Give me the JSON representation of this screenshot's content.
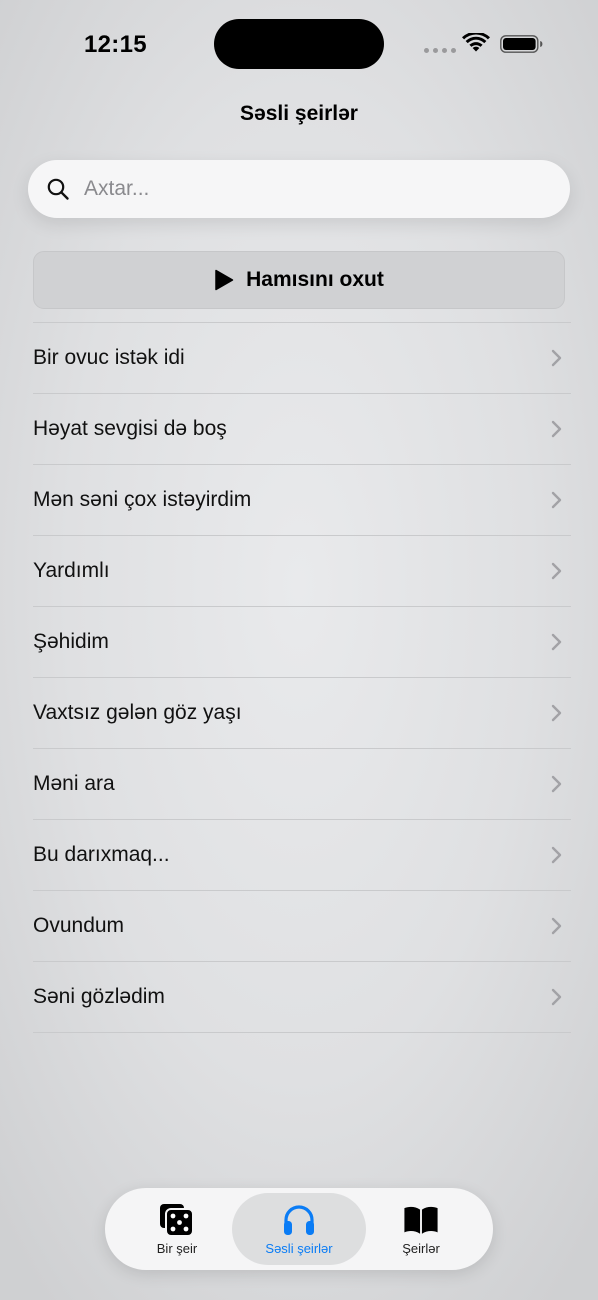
{
  "status_bar": {
    "time": "12:15"
  },
  "header": {
    "title": "Səsli şeirlər"
  },
  "search": {
    "placeholder": "Axtar...",
    "value": ""
  },
  "play_all": {
    "label": "Hamısını oxut"
  },
  "poems": [
    {
      "title": "Bir ovuc istək idi"
    },
    {
      "title": "Həyat sevgisi də boş"
    },
    {
      "title": "Mən səni çox istəyirdim"
    },
    {
      "title": "Yardımlı"
    },
    {
      "title": "Şəhidim"
    },
    {
      "title": "Vaxtsız gələn göz yaşı"
    },
    {
      "title": "Məni ara"
    },
    {
      "title": "Bu darıxmaq..."
    },
    {
      "title": "Ovundum"
    },
    {
      "title": "Səni gözlədim"
    }
  ],
  "tab_bar": {
    "tabs": [
      {
        "label": "Bir şeir",
        "icon": "dice-icon",
        "selected": false
      },
      {
        "label": "Səsli şeirlər",
        "icon": "headphones-icon",
        "selected": true
      },
      {
        "label": "Şeirlər",
        "icon": "book-icon",
        "selected": false
      }
    ]
  },
  "colors": {
    "accent": "#0a7cf5",
    "chevron": "#a2a2a6"
  }
}
